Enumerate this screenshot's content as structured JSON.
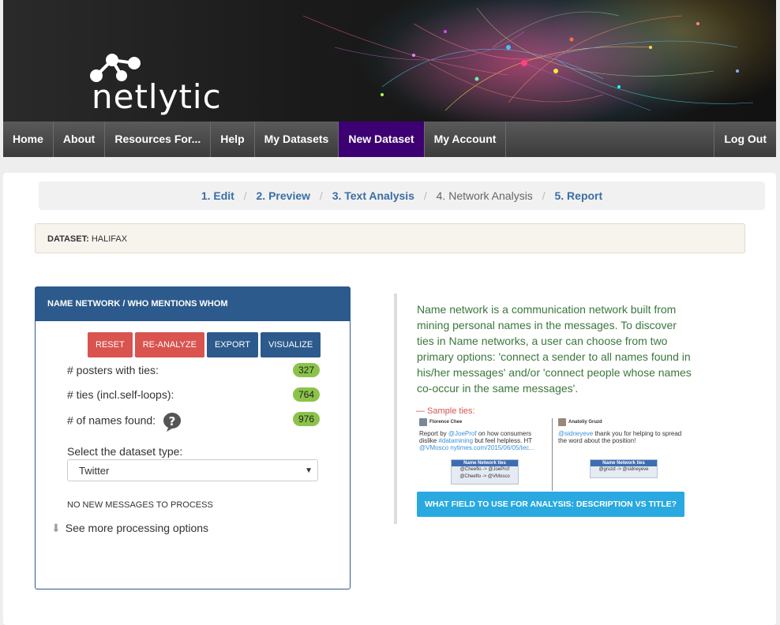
{
  "brand": {
    "logo_text": "netlytic"
  },
  "nav": {
    "home": "Home",
    "about": "About",
    "resources": "Resources For...",
    "help": "Help",
    "my_datasets": "My Datasets",
    "new_dataset": "New Dataset",
    "my_account": "My Account",
    "logout": "Log Out"
  },
  "steps": {
    "edit": "1. Edit",
    "preview": "2. Preview",
    "text_analysis": "3. Text Analysis",
    "network_analysis": "4. Network Analysis",
    "report": "5. Report",
    "separator": "/"
  },
  "dataset": {
    "label": "DATASET:",
    "name": "HALIFAX"
  },
  "panel": {
    "title": "NAME NETWORK / WHO MENTIONS WHOM",
    "buttons": {
      "reset": "RESET",
      "reanalyze": "RE-ANALYZE",
      "export": "EXPORT",
      "visualize": "VISUALIZE"
    },
    "stats": [
      {
        "label": "# posters with ties:",
        "value": "327"
      },
      {
        "label": "# ties (incl.self-loops):",
        "value": "764"
      },
      {
        "label": "# of names found:",
        "value": "976"
      }
    ],
    "select_label": "Select the dataset type:",
    "select_value": "Twitter",
    "no_new": "NO NEW MESSAGES TO PROCESS",
    "more_options": "See more processing options"
  },
  "info": {
    "text": "Name network is a communication network built from mining personal names in the messages. To discover ties in Name networks, a user can choose from two primary options: 'connect a sender to all names found in his/her messages' and/or 'connect people whose names co-occur in the same messages'.",
    "sample_label": "— Sample ties:",
    "tweet1": {
      "name": "Florence Chee",
      "text_pre": "Report by ",
      "mention1": "@JoeProf",
      "text_mid": " on how consumers dislike ",
      "hashtag": "#datamining",
      "text_post": " but feel helpless. HT ",
      "mention2": "@VMosco",
      "link": " nytimes.com/2015/06/05/tec...",
      "ties_title": "Name Network  ties",
      "tie1": "@Cheeflo -> @JoeProf",
      "tie2": "@Cheeflo -> @VMosco"
    },
    "tweet2": {
      "name": "Anatoliy Gruzd",
      "mention": "@sidneyeve",
      "text": " thank you for helping to spread the word about the position!",
      "ties_title": "Name Network  ties",
      "tie1": "@gruzd -> @sidneyeve"
    },
    "cta": "WHAT FIELD TO USE FOR ANALYSIS: DESCRIPTION VS TITLE?"
  }
}
